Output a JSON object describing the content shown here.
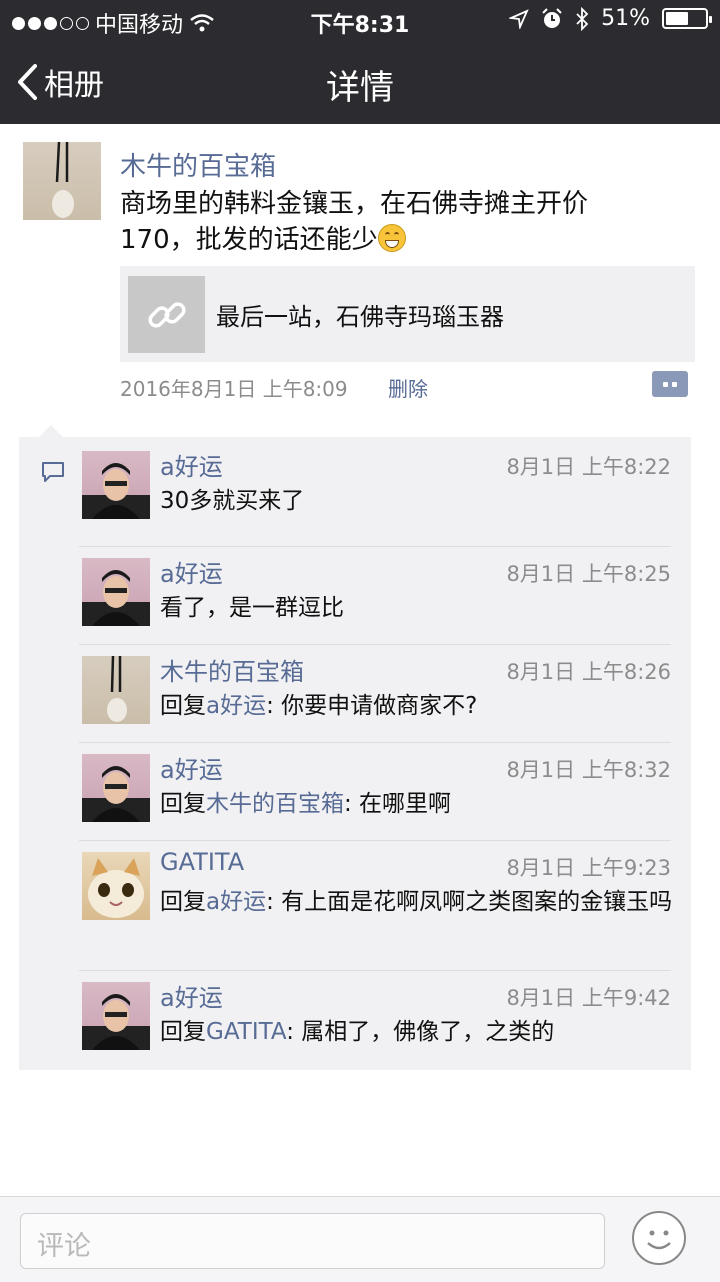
{
  "status": {
    "carrier": "中国移动",
    "time": "下午8:31",
    "battery": "51%"
  },
  "nav": {
    "back_label": "相册",
    "title": "详情"
  },
  "post": {
    "author": "木牛的百宝箱",
    "text_line1": "商场里的韩料金镶玉，在石佛寺摊主开价",
    "text_line2": "170，批发的话还能少",
    "link_title": "最后一站，石佛寺玛瑙玉器",
    "datetime": "2016年8月1日 上午8:09",
    "delete_label": "删除"
  },
  "comments": [
    {
      "name": "a好运",
      "time": "8月1日 上午8:22",
      "reply_prefix": "",
      "reply_to": "",
      "text": "30多就买来了",
      "avatar": "person"
    },
    {
      "name": "a好运",
      "time": "8月1日 上午8:25",
      "reply_prefix": "",
      "reply_to": "",
      "text": "看了，是一群逗比",
      "avatar": "person"
    },
    {
      "name": "木牛的百宝箱",
      "time": "8月1日 上午8:26",
      "reply_prefix": "回复",
      "reply_to": "a好运",
      "text": ": 你要申请做商家不?",
      "avatar": "jade"
    },
    {
      "name": "a好运",
      "time": "8月1日 上午8:32",
      "reply_prefix": "回复",
      "reply_to": "木牛的百宝箱",
      "text": ": 在哪里啊",
      "avatar": "person"
    },
    {
      "name": "GATITA",
      "time": "8月1日 上午9:23",
      "reply_prefix": "回复",
      "reply_to": "a好运",
      "text": ": 有上面是花啊凤啊之类图案的金镶玉吗",
      "avatar": "cat"
    },
    {
      "name": "a好运",
      "time": "8月1日 上午9:42",
      "reply_prefix": "回复",
      "reply_to": "GATITA",
      "text": ": 属相了，佛像了，之类的",
      "avatar": "person"
    }
  ],
  "input": {
    "placeholder": "评论"
  },
  "colors": {
    "link_blue": "#576b95",
    "nav_bg": "#2b2b30",
    "comment_bg": "#f1f1f3"
  }
}
